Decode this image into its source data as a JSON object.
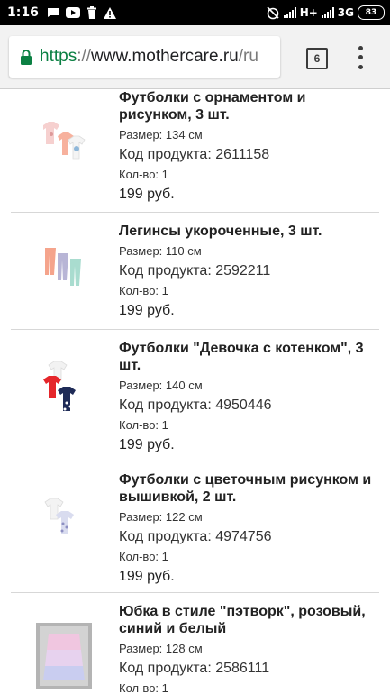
{
  "status_bar": {
    "time": "1:16",
    "network": "H+",
    "network2": "3G",
    "battery": "83"
  },
  "browser": {
    "url_scheme": "https",
    "url_sep": "://",
    "url_host": "www.mothercare.ru",
    "url_tail": "/ru",
    "tab_count": "6"
  },
  "products": [
    {
      "title": "Футболки с орнаментом и рисунком, 3 шт.",
      "size": "Размер: 134 см",
      "code": "Код продукта: 2611158",
      "qty": "Кол-во: 1",
      "price": "199 руб."
    },
    {
      "title": "Легинсы укороченные, 3 шт.",
      "size": "Размер: 110 см",
      "code": "Код продукта: 2592211",
      "qty": "Кол-во: 1",
      "price": "199 руб."
    },
    {
      "title": "Футболки \"Девочка с котенком\", 3 шт.",
      "size": "Размер: 140 см",
      "code": "Код продукта: 4950446",
      "qty": "Кол-во: 1",
      "price": "199 руб."
    },
    {
      "title": "Футболки с цветочным рисунком и вышивкой, 2 шт.",
      "size": "Размер: 122 см",
      "code": "Код продукта: 4974756",
      "qty": "Кол-во: 1",
      "price": "199 руб."
    },
    {
      "title": "Юбка в стиле \"пэтворк\", розовый, синий и белый",
      "size": "Размер: 128 см",
      "code": "Код продукта: 2586111",
      "qty": "Кол-во: 1",
      "price": ""
    }
  ]
}
